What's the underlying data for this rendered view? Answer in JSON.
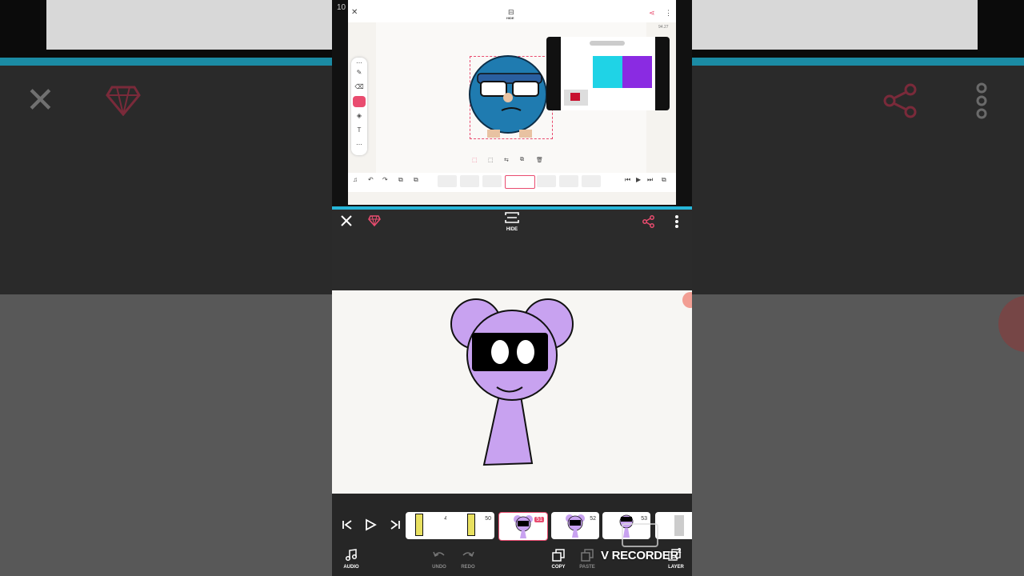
{
  "background": {
    "cyan_accent": "#1b8ba4",
    "icons": [
      "close-icon",
      "diamond-icon",
      "share-icon",
      "more-vertical-icon"
    ]
  },
  "tablet": {
    "status_time": "10",
    "hide_label": "HIDE",
    "zoom": "94.27",
    "side_tools": [
      "more-icon",
      "pen-icon",
      "eraser-icon",
      "lasso-icon",
      "bucket-icon",
      "text-icon",
      "more-icon"
    ],
    "selection_tools": [
      "CUT",
      "TRANSF",
      "FLIP",
      "DUPL",
      "REMOVE"
    ],
    "bottom_tools": [
      "AUDIO",
      "UNDO",
      "REDO",
      "COPY",
      "PASTE"
    ],
    "frame_numbers": [
      "3",
      "13",
      "14",
      "15",
      "16",
      "17",
      "18",
      "19"
    ],
    "layer_label": "LAYER"
  },
  "app_bar": {
    "hide_label": "HIDE",
    "accent": "#e94c6f"
  },
  "timeline": {
    "frames": [
      {
        "number": "49",
        "selected": false
      },
      {
        "number": "50",
        "selected": false
      },
      {
        "number": "51",
        "selected": true
      },
      {
        "number": "52",
        "selected": false
      },
      {
        "number": "53",
        "selected": false
      }
    ],
    "bottom": {
      "audio": "AUDIO",
      "undo": "UNDO",
      "redo": "REDO",
      "copy": "COPY",
      "paste": "PASTE",
      "layer": "LAYER",
      "layer_count": "2"
    }
  },
  "watermark": "V RECORDER"
}
